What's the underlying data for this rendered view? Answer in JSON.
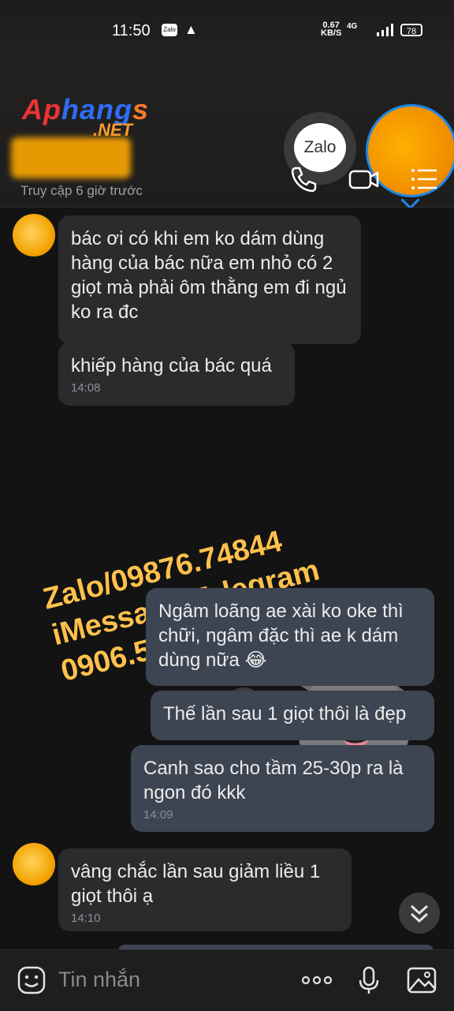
{
  "status_bar": {
    "time": "11:50",
    "net_speed_value": "0.67",
    "net_speed_unit": "KB/S",
    "network": "4G",
    "battery": "78",
    "zalo_mini": "Zalo"
  },
  "watermark": {
    "logo_part1": "Ap",
    "logo_part2": "hang",
    "logo_part3": "s",
    "logo_suffix": ".NET",
    "contact_lines": [
      "Zalo/09876.74844",
      "iMessage/Telegram",
      "0906.552.756"
    ]
  },
  "bubble_label": "Zalo",
  "header": {
    "last_seen": "Truy cập 6 giờ trước"
  },
  "messages": [
    {
      "side": "them",
      "text": "bác ơi có khi em ko dám dùng hàng của bác nữa em nhỏ có 2 giọt mà phải ôm thằng em đi ngủ ko ra đc",
      "time": ""
    },
    {
      "side": "them",
      "text": "khiếp hàng của bác quá",
      "time": "14:08"
    },
    {
      "side": "me",
      "text": "Ngâm loãng ae xài ko oke thì chữi, ngâm đặc thì ae k dám dùng nữa 😂",
      "time": ""
    },
    {
      "side": "me",
      "text": "Thế lần sau 1 giọt thôi là đẹp",
      "time": ""
    },
    {
      "side": "me",
      "text": "Canh sao cho tầm 25-30p ra là ngon đó kkk",
      "time": "14:09"
    },
    {
      "side": "them",
      "text": "vâng chắc lần sau giảm liều 1 giọt thôi ạ",
      "time": "14:10"
    }
  ],
  "sticker": {
    "text": "!!!"
  },
  "input": {
    "placeholder": "Tin nhắn"
  },
  "colors": {
    "accent": "#1f87e6",
    "bubble_them": "#2b2b2d",
    "bubble_me": "#3d4452",
    "watermark": "#ffc14c"
  }
}
